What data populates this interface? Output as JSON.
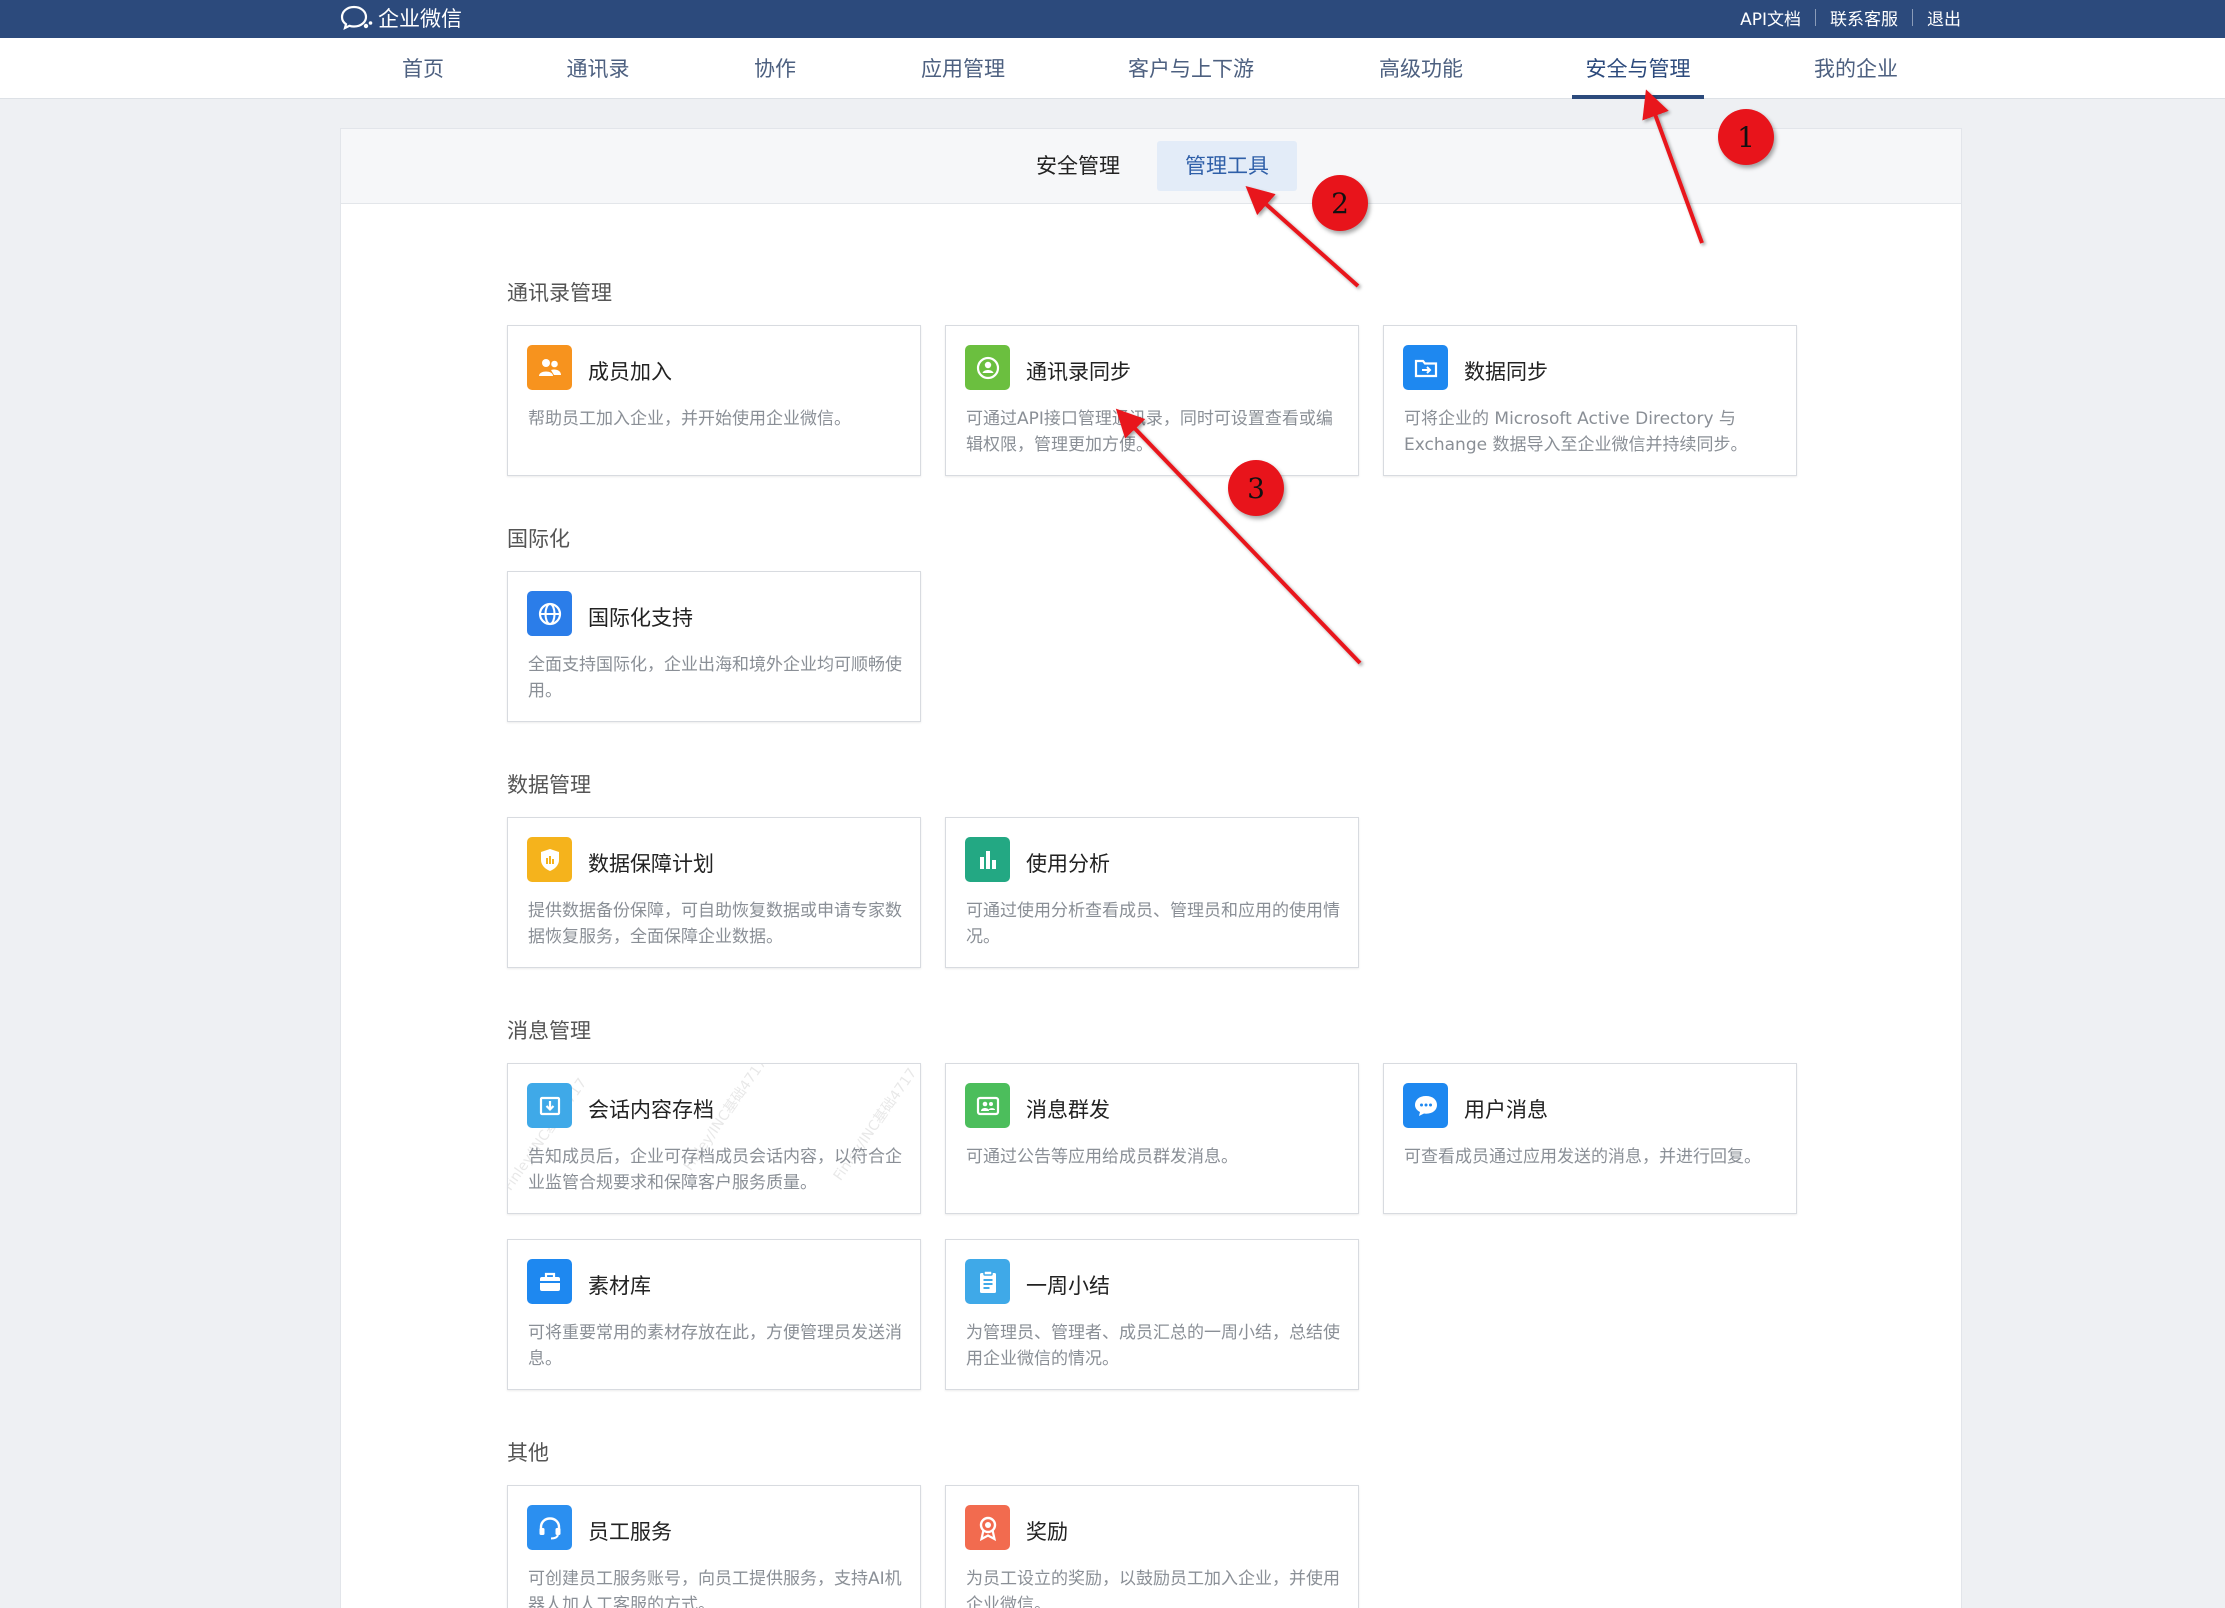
{
  "app": {
    "logo_text": "企业微信"
  },
  "top_links": [
    "API文档",
    "联系客服",
    "退出"
  ],
  "nav": {
    "items": [
      "首页",
      "通讯录",
      "协作",
      "应用管理",
      "客户与上下游",
      "高级功能",
      "安全与管理",
      "我的企业"
    ],
    "active": "安全与管理"
  },
  "subtabs": {
    "items": [
      "安全管理",
      "管理工具"
    ],
    "active": "管理工具"
  },
  "sections": [
    {
      "title": "通讯录管理",
      "cards": [
        {
          "title": "成员加入",
          "desc": "帮助员工加入企业，并开始使用企业微信。",
          "icon": "members-icon",
          "color": "#f7931e"
        },
        {
          "title": "通讯录同步",
          "desc": "可通过API接口管理通讯录，同时可设置查看或编辑权限，管理更加方便。",
          "icon": "contact-sync-icon",
          "color": "#6bbf3f"
        },
        {
          "title": "数据同步",
          "desc": "可将企业的 Microsoft Active Directory 与 Exchange 数据导入至企业微信并持续同步。",
          "icon": "data-sync-icon",
          "color": "#1e88f0"
        }
      ]
    },
    {
      "title": "国际化",
      "cards": [
        {
          "title": "国际化支持",
          "desc": "全面支持国际化，企业出海和境外企业均可顺畅使用。",
          "icon": "globe-icon",
          "color": "#2b7de9"
        }
      ]
    },
    {
      "title": "数据管理",
      "cards": [
        {
          "title": "数据保障计划",
          "desc": "提供数据备份保障，可自助恢复数据或申请专家数据恢复服务，全面保障企业数据。",
          "icon": "shield-icon",
          "color": "#f5b31c"
        },
        {
          "title": "使用分析",
          "desc": "可通过使用分析查看成员、管理员和应用的使用情况。",
          "icon": "bar-chart-icon",
          "color": "#23a883"
        }
      ]
    },
    {
      "title": "消息管理",
      "cards": [
        {
          "title": "会话内容存档",
          "desc": "告知成员后，企业可存档成员会话内容，以符合企业监管合规要求和保障客户服务质量。",
          "icon": "archive-icon",
          "color": "#3fa9e8"
        },
        {
          "title": "消息群发",
          "desc": "可通过公告等应用给成员群发消息。",
          "icon": "broadcast-icon",
          "color": "#4cbe5c"
        },
        {
          "title": "用户消息",
          "desc": "可查看成员通过应用发送的消息，并进行回复。",
          "icon": "chat-bubble-icon",
          "color": "#1e88f0"
        },
        {
          "title": "素材库",
          "desc": "可将重要常用的素材存放在此，方便管理员发送消息。",
          "icon": "briefcase-icon",
          "color": "#1e88f0"
        },
        {
          "title": "一周小结",
          "desc": "为管理员、管理者、成员汇总的一周小结，总结使用企业微信的情况。",
          "icon": "clipboard-icon",
          "color": "#3fa9e8"
        }
      ]
    },
    {
      "title": "其他",
      "cards": [
        {
          "title": "员工服务",
          "desc": "可创建员工服务账号，向员工提供服务，支持AI机器人加人工客服的方式。",
          "icon": "headset-icon",
          "color": "#2b8ff0"
        },
        {
          "title": "奖励",
          "desc": "为员工设立的奖励，以鼓励员工加入企业，并使用企业微信。",
          "icon": "award-icon",
          "color": "#f26b4f"
        }
      ]
    }
  ],
  "watermark": "Finley/INC基础4717",
  "annotations": [
    "1",
    "2",
    "3"
  ],
  "colors": {
    "topbar": "#2c4a7c",
    "active_tab_bg": "#e3ecf8",
    "arrow": "#e8141b"
  }
}
